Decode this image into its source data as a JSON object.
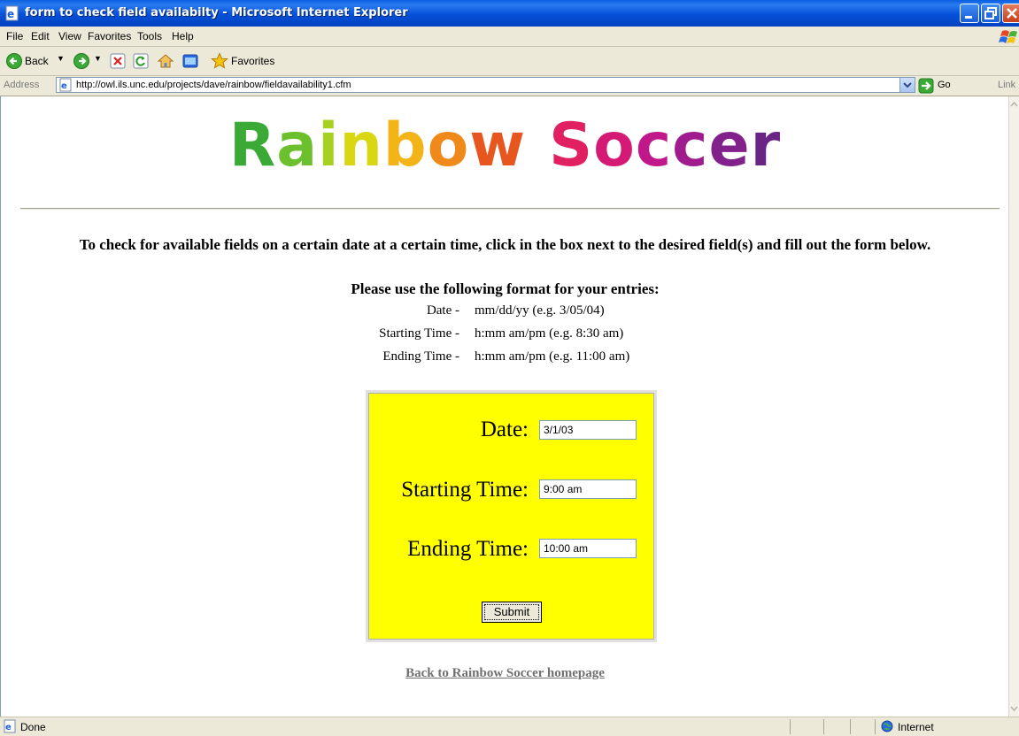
{
  "window": {
    "title": "form to check field availabilty - Microsoft Internet Explorer"
  },
  "menu": [
    "File",
    "Edit",
    "View",
    "Favorites",
    "Tools",
    "Help"
  ],
  "toolbar": {
    "back_label": "Back",
    "favorites_label": "Favorites"
  },
  "address_bar": {
    "label": "Address",
    "url": "http://owl.ils.unc.edu/projects/dave/rainbow/fieldavailability1.cfm",
    "go_label": "Go",
    "links_label": "Link"
  },
  "page": {
    "banner": {
      "letters": [
        {
          "ch": "R",
          "color": "#3aa935"
        },
        {
          "ch": "a",
          "color": "#6cc02e"
        },
        {
          "ch": "i",
          "color": "#a5d21e"
        },
        {
          "ch": "n",
          "color": "#d9d712"
        },
        {
          "ch": "b",
          "color": "#f2b416"
        },
        {
          "ch": "o",
          "color": "#ef8a1a"
        },
        {
          "ch": "w",
          "color": "#e7561f"
        },
        {
          "ch": " ",
          "color": "#000000"
        },
        {
          "ch": "S",
          "color": "#e02060"
        },
        {
          "ch": "o",
          "color": "#d41a74"
        },
        {
          "ch": "c",
          "color": "#c0188a"
        },
        {
          "ch": "c",
          "color": "#a01c8e"
        },
        {
          "ch": "e",
          "color": "#82208c"
        },
        {
          "ch": "r",
          "color": "#6a2486"
        }
      ]
    },
    "intro_text": "To check for available fields on a certain date at a certain time, click in the box next to the desired field(s) and fill out the form below.",
    "format_title": "Please use the following format for your entries:",
    "formats": [
      {
        "key": "Date -",
        "value": "mm/dd/yy (e.g. 3/05/04)"
      },
      {
        "key": "Starting Time -",
        "value": "h:mm am/pm (e.g. 8:30 am)"
      },
      {
        "key": "Ending Time -",
        "value": "h:mm am/pm (e.g. 11:00 am)"
      }
    ],
    "form": {
      "date_label": "Date:",
      "date_value": "3/1/03",
      "start_label": "Starting Time:",
      "start_value": "9:00 am",
      "end_label": "Ending Time:",
      "end_value": "10:00 am",
      "submit_label": "Submit",
      "background_color": "#ffff00"
    },
    "back_link": "Back to Rainbow Soccer homepage"
  },
  "status": {
    "left": "Done",
    "zone": "Internet"
  }
}
